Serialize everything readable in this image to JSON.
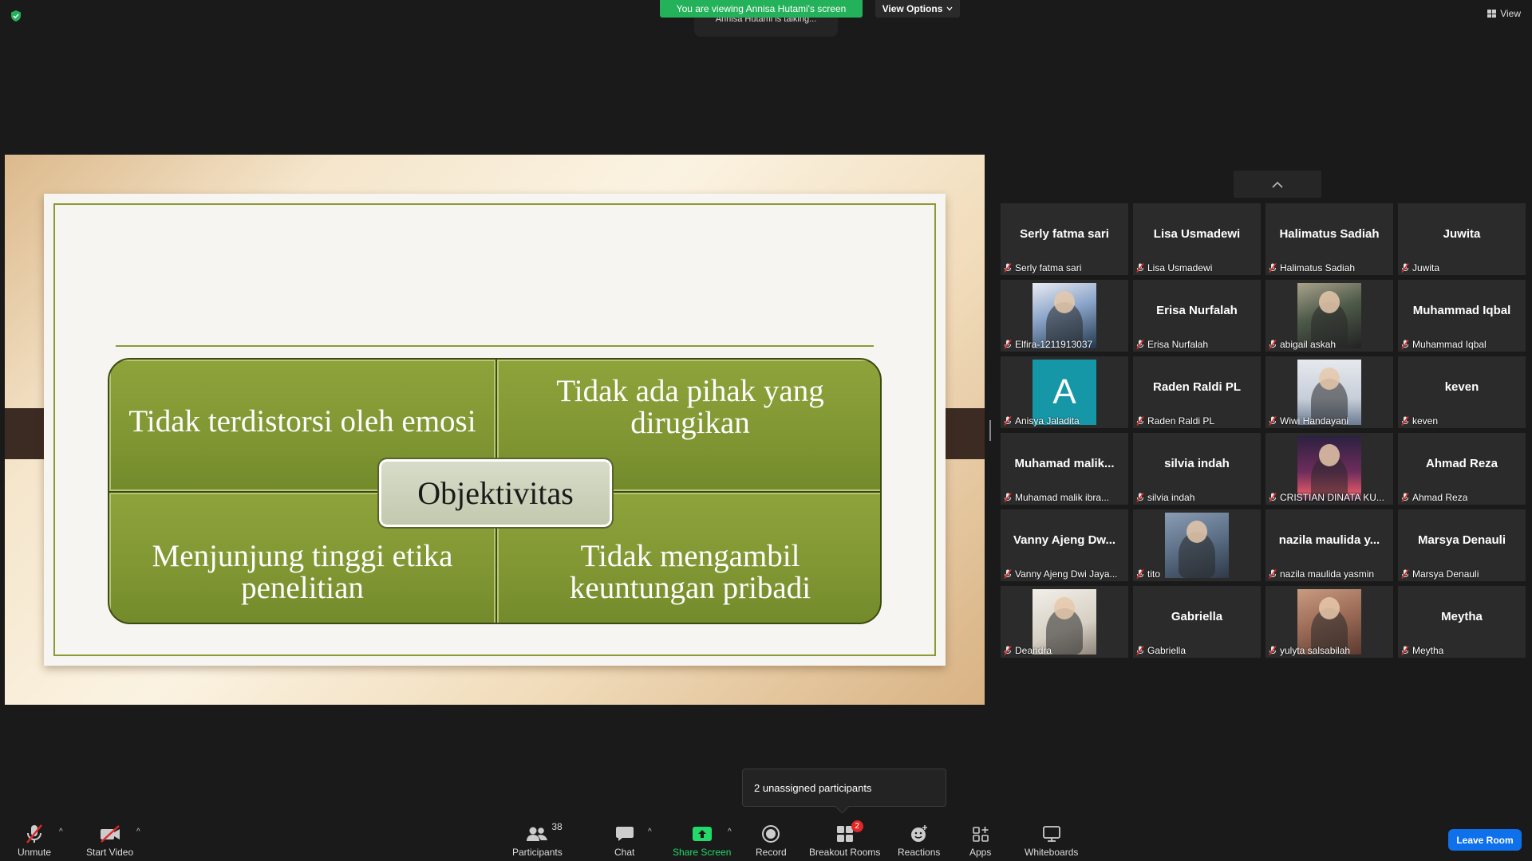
{
  "banner": {
    "viewing": "You are viewing Annisa Hutami's screen",
    "talking": "Annisa Hutami is talking...",
    "view_options": "View Options",
    "view": "View"
  },
  "slide": {
    "center": "Objektivitas",
    "q1": "Tidak terdistorsi oleh emosi",
    "q2": "Tidak ada pihak yang dirugikan",
    "q3": "Menjunjung tinggi etika penelitian",
    "q4": "Tidak mengambil keuntungan pribadi",
    "colors": {
      "quad": "#809633",
      "frame": "#8b9a35",
      "center": "#c9cfb5"
    }
  },
  "participants": [
    {
      "big": "Serly fatma sari",
      "name": "Serly fatma sari",
      "video": ""
    },
    {
      "big": "Lisa Usmadewi",
      "name": "Lisa Usmadewi",
      "video": ""
    },
    {
      "big": "Halimatus Sadiah",
      "name": "Halimatus Sadiah",
      "video": ""
    },
    {
      "big": "Juwita",
      "name": "Juwita",
      "video": ""
    },
    {
      "big": "",
      "name": "Elfira-1211913037",
      "video": "elfira"
    },
    {
      "big": "Erisa Nurfalah",
      "name": "Erisa Nurfalah",
      "video": ""
    },
    {
      "big": "",
      "name": "abigail askah",
      "video": "abigail"
    },
    {
      "big": "Muhammad Iqbal",
      "name": "Muhammad Iqbal",
      "video": ""
    },
    {
      "big": "",
      "name": "Anisya Jaladita",
      "video": "anisya",
      "initial": "A"
    },
    {
      "big": "Raden Raldi PL",
      "name": "Raden Raldi PL",
      "video": ""
    },
    {
      "big": "",
      "name": "Wiwi Handayani",
      "video": "wiwi"
    },
    {
      "big": "keven",
      "name": "keven",
      "video": ""
    },
    {
      "big": "Muhamad  malik...",
      "name": "Muhamad malik ibra...",
      "video": ""
    },
    {
      "big": "silvia indah",
      "name": "silvia indah",
      "video": ""
    },
    {
      "big": "",
      "name": "CRISTIAN DINATA KU...",
      "video": "cristian"
    },
    {
      "big": "Ahmad Reza",
      "name": "Ahmad Reza",
      "video": ""
    },
    {
      "big": "Vanny  Ajeng  Dw...",
      "name": "Vanny Ajeng Dwi Jaya...",
      "video": ""
    },
    {
      "big": "",
      "name": "tito",
      "video": "tito"
    },
    {
      "big": "nazila  maulida  y...",
      "name": "nazila maulida yasmin",
      "video": ""
    },
    {
      "big": "Marsya Denauli",
      "name": "Marsya Denauli",
      "video": ""
    },
    {
      "big": "",
      "name": "Deandra",
      "video": "deandra"
    },
    {
      "big": "Gabriella",
      "name": "Gabriella",
      "video": ""
    },
    {
      "big": "",
      "name": "yulyta salsabilah",
      "video": "yulyta"
    },
    {
      "big": "Meytha",
      "name": "Meytha",
      "video": ""
    }
  ],
  "unassigned": "2 unassigned participants",
  "toolbar": {
    "unmute": "Unmute",
    "start_video": "Start Video",
    "participants": "Participants",
    "participants_count": "38",
    "chat": "Chat",
    "share_screen": "Share Screen",
    "record": "Record",
    "breakout_rooms": "Breakout Rooms",
    "breakout_badge": "2",
    "reactions": "Reactions",
    "apps": "Apps",
    "whiteboards": "Whiteboards",
    "leave_room": "Leave Room"
  }
}
